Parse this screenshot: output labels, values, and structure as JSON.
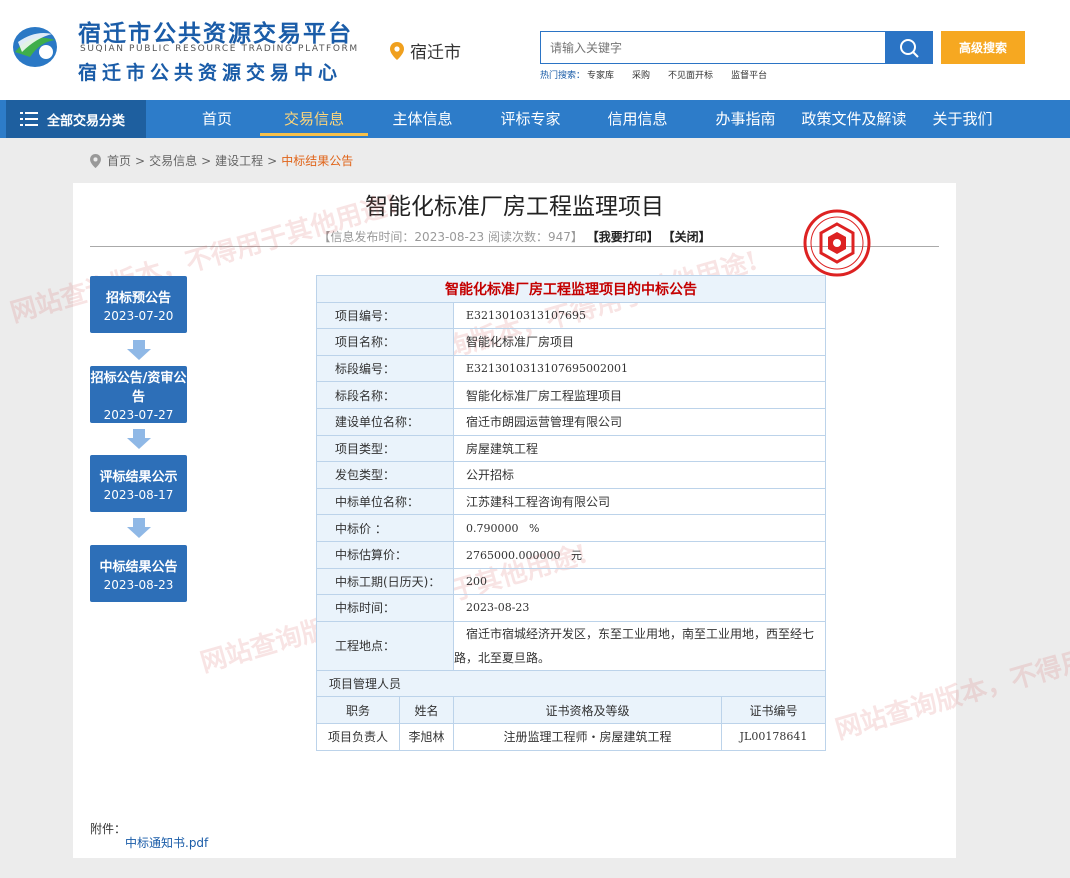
{
  "header": {
    "logo_cn_main": "宿迁市公共资源交易平台",
    "logo_en": "SUQIAN PUBLIC RESOURCE TRADING PLATFORM",
    "logo_cn_sub": "宿迁市公共资源交易中心",
    "city": "宿迁市",
    "search_placeholder": "请输入关键字",
    "advanced_search": "高级搜索",
    "hot_label": "热门搜索：",
    "hot_keywords": [
      "专家库",
      "采购",
      "不见面开标",
      "监督平台"
    ]
  },
  "nav": {
    "all_categories": "全部交易分类",
    "items": [
      "首页",
      "交易信息",
      "主体信息",
      "评标专家",
      "信用信息",
      "办事指南",
      "政策文件及解读",
      "关于我们"
    ],
    "active": "交易信息"
  },
  "breadcrumb": [
    "首页",
    "交易信息",
    "建设工程",
    "中标结果公告"
  ],
  "article": {
    "title": "智能化标准厂房工程监理项目",
    "meta": "【信息发布时间：2023-08-23  阅读次数：947】",
    "print": "【我要打印】",
    "close": "【关闭】"
  },
  "timeline": [
    {
      "label": "招标预公告",
      "date": "2023-07-20"
    },
    {
      "label": "招标公告/资审公告",
      "date": "2023-07-27"
    },
    {
      "label": "评标结果公示",
      "date": "2023-08-17"
    },
    {
      "label": "中标结果公告",
      "date": "2023-08-23"
    }
  ],
  "notice": {
    "heading": "智能化标准厂房工程监理项目的中标公告",
    "rows": [
      {
        "k": "项目编号：",
        "v": "E3213010313107695"
      },
      {
        "k": "项目名称：",
        "v": "智能化标准厂房项目"
      },
      {
        "k": "标段编号：",
        "v": "E3213010313107695002001"
      },
      {
        "k": "标段名称：",
        "v": "智能化标准厂房工程监理项目"
      },
      {
        "k": "建设单位名称：",
        "v": "宿迁市朗园运营管理有限公司"
      },
      {
        "k": "项目类型：",
        "v": "房屋建筑工程"
      },
      {
        "k": "发包类型：",
        "v": "公开招标"
      },
      {
        "k": "中标单位名称：",
        "v": "江苏建科工程咨询有限公司"
      },
      {
        "k": "中标价 ：",
        "v": "0.790000   %"
      },
      {
        "k": "中标估算价：",
        "v": "2765000.000000   元"
      },
      {
        "k": "中标工期(日历天)：",
        "v": "200"
      },
      {
        "k": "中标时间：",
        "v": "2023-08-23"
      }
    ],
    "location_label": "工程地点：",
    "location_value": "宿迁市宿城经济开发区，东至工业用地，南至工业用地，西至经七路，北至夏旦路。",
    "manager_section": "项目管理人员",
    "manager_headers": [
      "职务",
      "姓名",
      "证书资格及等级",
      "证书编号"
    ],
    "manager_row": [
      "项目负责人",
      "李旭林",
      "注册监理工程师・房屋建筑工程",
      "JL00178641"
    ]
  },
  "attachment": {
    "label": "附件：",
    "file": "中标通知书.pdf"
  },
  "watermark_text": "网站查询版本，不得用于其他用途!"
}
